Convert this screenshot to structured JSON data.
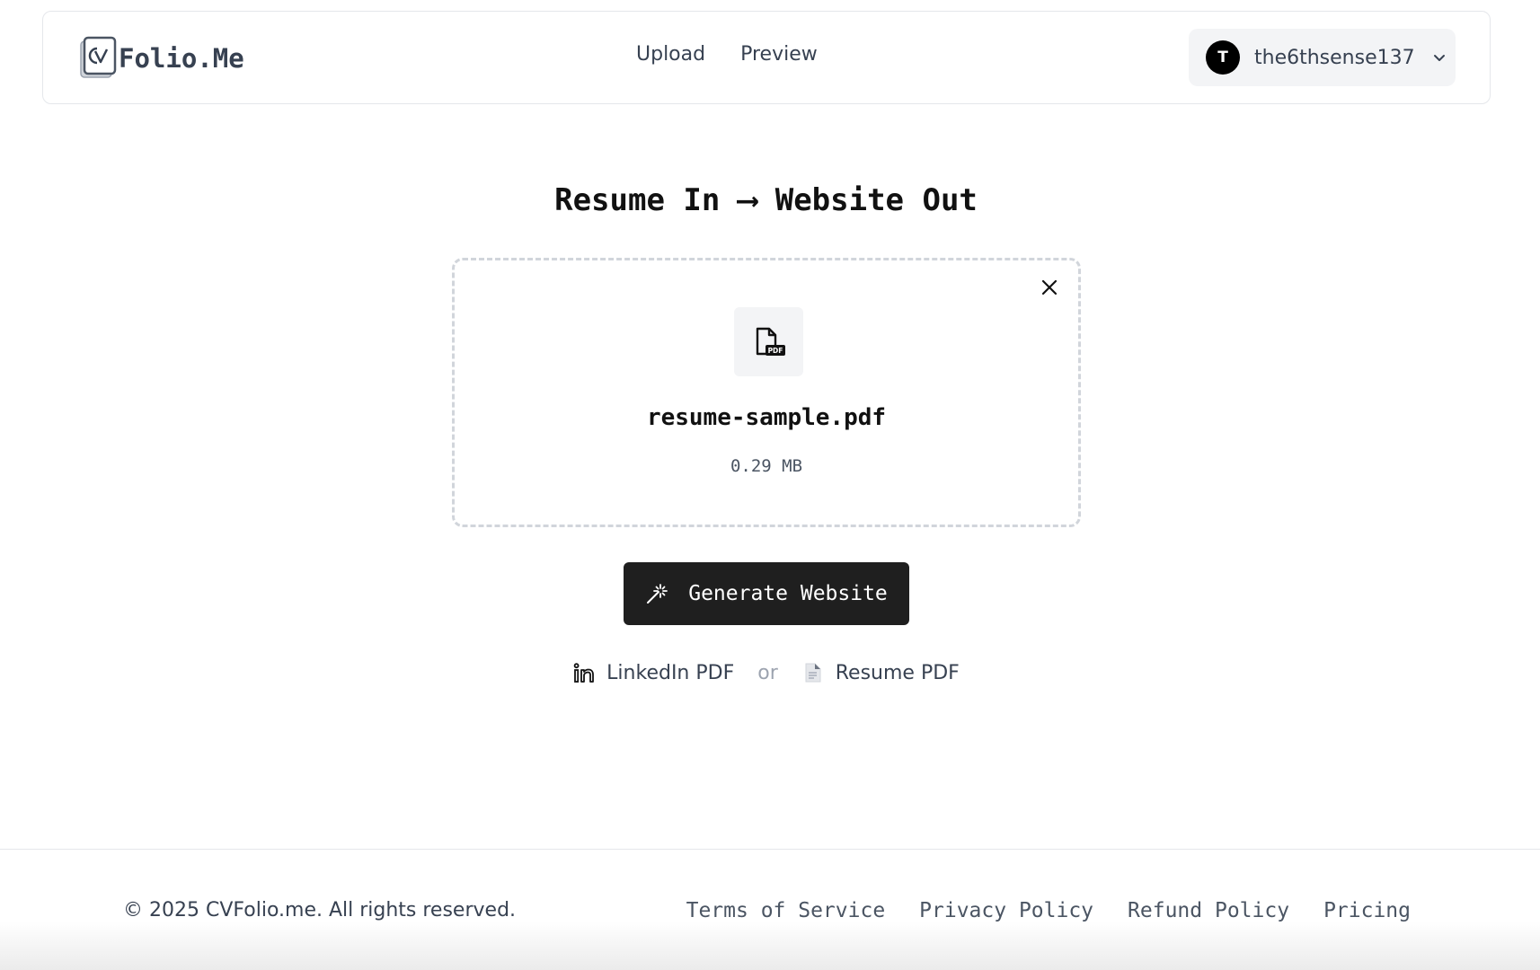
{
  "header": {
    "logo_text": "Folio.Me",
    "nav": [
      {
        "label": "Upload"
      },
      {
        "label": "Preview"
      }
    ],
    "user": {
      "avatar_initial": "T",
      "username": "the6thsense137"
    }
  },
  "hero": {
    "title": "Resume In ⟶ Website Out"
  },
  "upload": {
    "file_name": "resume-sample.pdf",
    "file_size": "0.29 MB",
    "file_icon": "pdf-file-icon",
    "close_icon": "close-icon"
  },
  "actions": {
    "generate_label": "Generate Website",
    "generate_icon": "magic-wand-icon"
  },
  "sources": {
    "linkedin_label": "LinkedIn PDF",
    "separator": "or",
    "resume_label": "Resume PDF"
  },
  "footer": {
    "copyright": "© 2025 CVFolio.me. All rights reserved.",
    "links": [
      {
        "label": "Terms of Service"
      },
      {
        "label": "Privacy Policy"
      },
      {
        "label": "Refund Policy"
      },
      {
        "label": "Pricing"
      }
    ]
  },
  "colors": {
    "primary_button": "#1f1f1f",
    "border": "#e5e7eb",
    "text": "#374151"
  }
}
